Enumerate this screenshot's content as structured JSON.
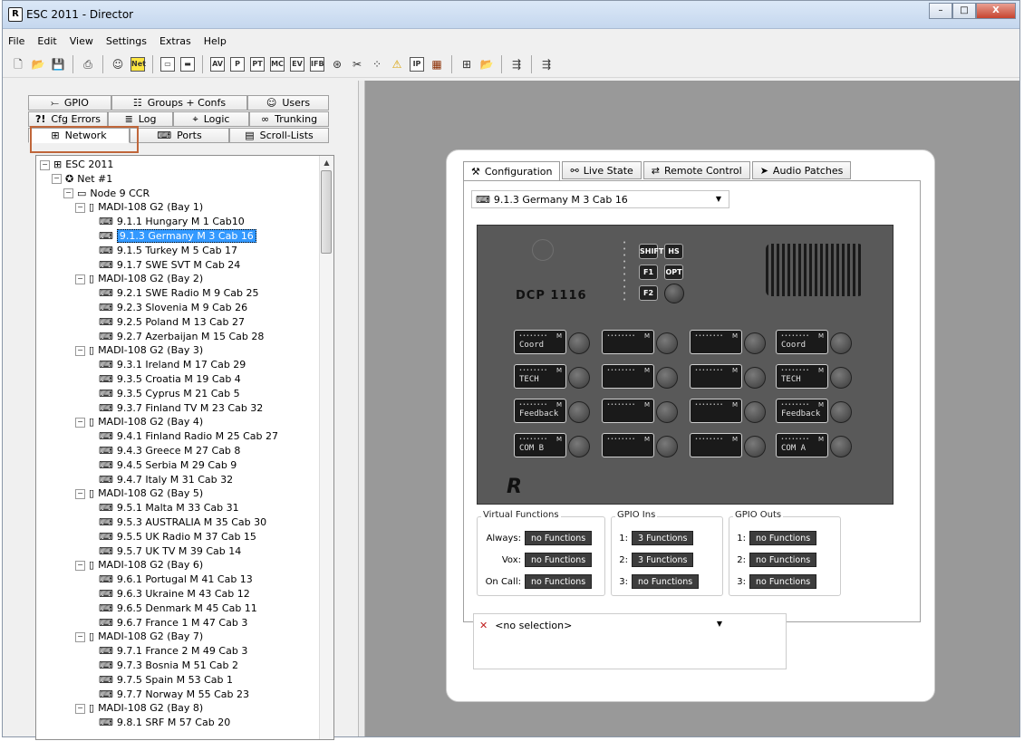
{
  "window": {
    "title": "ESC 2011 - Director",
    "controls": [
      "–",
      "□",
      "X"
    ]
  },
  "menu": [
    "File",
    "Edit",
    "View",
    "Settings",
    "Extras",
    "Help"
  ],
  "toolbar": [
    "new",
    "open",
    "save",
    "print",
    "user",
    "Net",
    "layout-1",
    "layout-2",
    "AV",
    "P",
    "PT",
    "MC",
    "EV",
    "IFB",
    "globe",
    "tools",
    "dots",
    "warn",
    "IP",
    "grid",
    "net-a",
    "net-b",
    "net-c",
    "net-d"
  ],
  "left_tabs": {
    "row1": [
      {
        "icon": "⤚",
        "label": "GPIO"
      },
      {
        "icon": "☷",
        "label": "Groups + Confs"
      },
      {
        "icon": "☺",
        "label": "Users"
      }
    ],
    "row2": [
      {
        "icon": "?!",
        "label": "Cfg Errors"
      },
      {
        "icon": "≣",
        "label": "Log"
      },
      {
        "icon": "⌖",
        "label": "Logic"
      },
      {
        "icon": "∞",
        "label": "Trunking"
      }
    ],
    "row3": [
      {
        "icon": "⊞",
        "label": "Network"
      },
      {
        "icon": "⌨",
        "label": "Ports"
      },
      {
        "icon": "▤",
        "label": "Scroll-Lists"
      }
    ]
  },
  "tree": [
    {
      "level": 0,
      "icon": "⊞",
      "label": "ESC 2011",
      "exp": "−"
    },
    {
      "level": 1,
      "icon": "✪",
      "label": "Net #1",
      "exp": "−"
    },
    {
      "level": 2,
      "icon": "▭",
      "label": "Node 9 CCR",
      "exp": "−"
    },
    {
      "level": 3,
      "icon": "▯",
      "label": "MADI-108 G2 (Bay  1)",
      "exp": "−"
    },
    {
      "level": 4,
      "icon": "⌨",
      "label": "9.1.1 Hungary M 1 Cab10"
    },
    {
      "level": 4,
      "icon": "⌨",
      "label": "9.1.3 Germany M 3 Cab 16",
      "selected": true
    },
    {
      "level": 4,
      "icon": "⌨",
      "label": "9.1.5 Turkey M 5 Cab 17"
    },
    {
      "level": 4,
      "icon": "⌨",
      "label": "9.1.7 SWE SVT M Cab 24"
    },
    {
      "level": 3,
      "icon": "▯",
      "label": "MADI-108 G2 (Bay  2)",
      "exp": "−"
    },
    {
      "level": 4,
      "icon": "⌨",
      "label": "9.2.1 SWE Radio M 9 Cab 25"
    },
    {
      "level": 4,
      "icon": "⌨",
      "label": "9.2.3 Slovenia M 9 Cab 26"
    },
    {
      "level": 4,
      "icon": "⌨",
      "label": "9.2.5 Poland M 13 Cab 27"
    },
    {
      "level": 4,
      "icon": "⌨",
      "label": "9.2.7 Azerbaijan M 15 Cab 28"
    },
    {
      "level": 3,
      "icon": "▯",
      "label": "MADI-108 G2 (Bay  3)",
      "exp": "−"
    },
    {
      "level": 4,
      "icon": "⌨",
      "label": "9.3.1 Ireland M 17 Cab 29"
    },
    {
      "level": 4,
      "icon": "⌨",
      "label": "9.3.5 Croatia M 19 Cab 4"
    },
    {
      "level": 4,
      "icon": "⌨",
      "label": "9.3.5 Cyprus M 21 Cab 5"
    },
    {
      "level": 4,
      "icon": "⌨",
      "label": "9.3.7 Finland TV M 23 Cab 32"
    },
    {
      "level": 3,
      "icon": "▯",
      "label": "MADI-108 G2 (Bay  4)",
      "exp": "−"
    },
    {
      "level": 4,
      "icon": "⌨",
      "label": "9.4.1 Finland Radio M 25 Cab 27"
    },
    {
      "level": 4,
      "icon": "⌨",
      "label": "9.4.3 Greece M 27 Cab 8"
    },
    {
      "level": 4,
      "icon": "⌨",
      "label": "9.4.5 Serbia M 29 Cab 9"
    },
    {
      "level": 4,
      "icon": "⌨",
      "label": "9.4.7 Italy M 31 Cab 32"
    },
    {
      "level": 3,
      "icon": "▯",
      "label": "MADI-108 G2 (Bay  5)",
      "exp": "−"
    },
    {
      "level": 4,
      "icon": "⌨",
      "label": "9.5.1 Malta M 33 Cab 31"
    },
    {
      "level": 4,
      "icon": "⌨",
      "label": "9.5.3 AUSTRALIA M 35 Cab 30"
    },
    {
      "level": 4,
      "icon": "⌨",
      "label": "9.5.5 UK Radio M 37 Cab 15"
    },
    {
      "level": 4,
      "icon": "⌨",
      "label": "9.5.7 UK TV M 39 Cab 14"
    },
    {
      "level": 3,
      "icon": "▯",
      "label": "MADI-108 G2 (Bay  6)",
      "exp": "−"
    },
    {
      "level": 4,
      "icon": "⌨",
      "label": "9.6.1 Portugal M 41 Cab 13"
    },
    {
      "level": 4,
      "icon": "⌨",
      "label": "9.6.3 Ukraine M 43 Cab 12"
    },
    {
      "level": 4,
      "icon": "⌨",
      "label": "9.6.5 Denmark M 45 Cab 11"
    },
    {
      "level": 4,
      "icon": "⌨",
      "label": "9.6.7 France 1 M 47 Cab 3"
    },
    {
      "level": 3,
      "icon": "▯",
      "label": "MADI-108 G2 (Bay  7)",
      "exp": "−"
    },
    {
      "level": 4,
      "icon": "⌨",
      "label": "9.7.1 France 2 M 49 Cab 3"
    },
    {
      "level": 4,
      "icon": "⌨",
      "label": "9.7.3 Bosnia M 51 Cab 2"
    },
    {
      "level": 4,
      "icon": "⌨",
      "label": "9.7.5 Spain M 53 Cab 1"
    },
    {
      "level": 4,
      "icon": "⌨",
      "label": "9.7.7 Norway M 55 Cab 23"
    },
    {
      "level": 3,
      "icon": "▯",
      "label": "MADI-108 G2 (Bay  8)",
      "exp": "−"
    },
    {
      "level": 4,
      "icon": "⌨",
      "label": "9.8.1 SRF M 57 Cab 20"
    }
  ],
  "config": {
    "tabs": [
      {
        "icon": "⚒",
        "label": "Configuration",
        "active": true
      },
      {
        "icon": "⚯",
        "label": "Live State"
      },
      {
        "icon": "⇄",
        "label": "Remote Control"
      },
      {
        "icon": "➤",
        "label": "Audio Patches"
      }
    ],
    "port_dropdown": "9.1.3 Germany M 3 Cab 16",
    "device_model": "DCP 1116",
    "small_keys": [
      "SHIFT",
      "HS",
      "F1",
      "OPT",
      "F2"
    ],
    "key_labels": [
      [
        "Coord",
        "",
        "",
        "Coord"
      ],
      [
        "TECH",
        "",
        "",
        "TECH"
      ],
      [
        "Feedback",
        "",
        "",
        "Feedback"
      ],
      [
        "COM B",
        "",
        "",
        "COM A"
      ]
    ],
    "key_marker": "M",
    "brand": "R",
    "virtual_functions": {
      "title": "Virtual Functions",
      "rows": [
        {
          "label": "Always:",
          "value": "no Functions"
        },
        {
          "label": "Vox:",
          "value": "no Functions"
        },
        {
          "label": "On Call:",
          "value": "no Functions"
        }
      ]
    },
    "gpio_ins": {
      "title": "GPIO Ins",
      "rows": [
        {
          "label": "1:",
          "value": "3 Functions"
        },
        {
          "label": "2:",
          "value": "3 Functions"
        },
        {
          "label": "3:",
          "value": "no Functions"
        }
      ]
    },
    "gpio_outs": {
      "title": "GPIO Outs",
      "rows": [
        {
          "label": "1:",
          "value": "no Functions"
        },
        {
          "label": "2:",
          "value": "no Functions"
        },
        {
          "label": "3:",
          "value": "no Functions"
        }
      ]
    },
    "selection_dropdown": "<no selection>"
  },
  "colors": {
    "accent_highlight": "#c0663a",
    "selection": "#3399ff",
    "device_panel": "#595959",
    "workspace": "#999999"
  }
}
